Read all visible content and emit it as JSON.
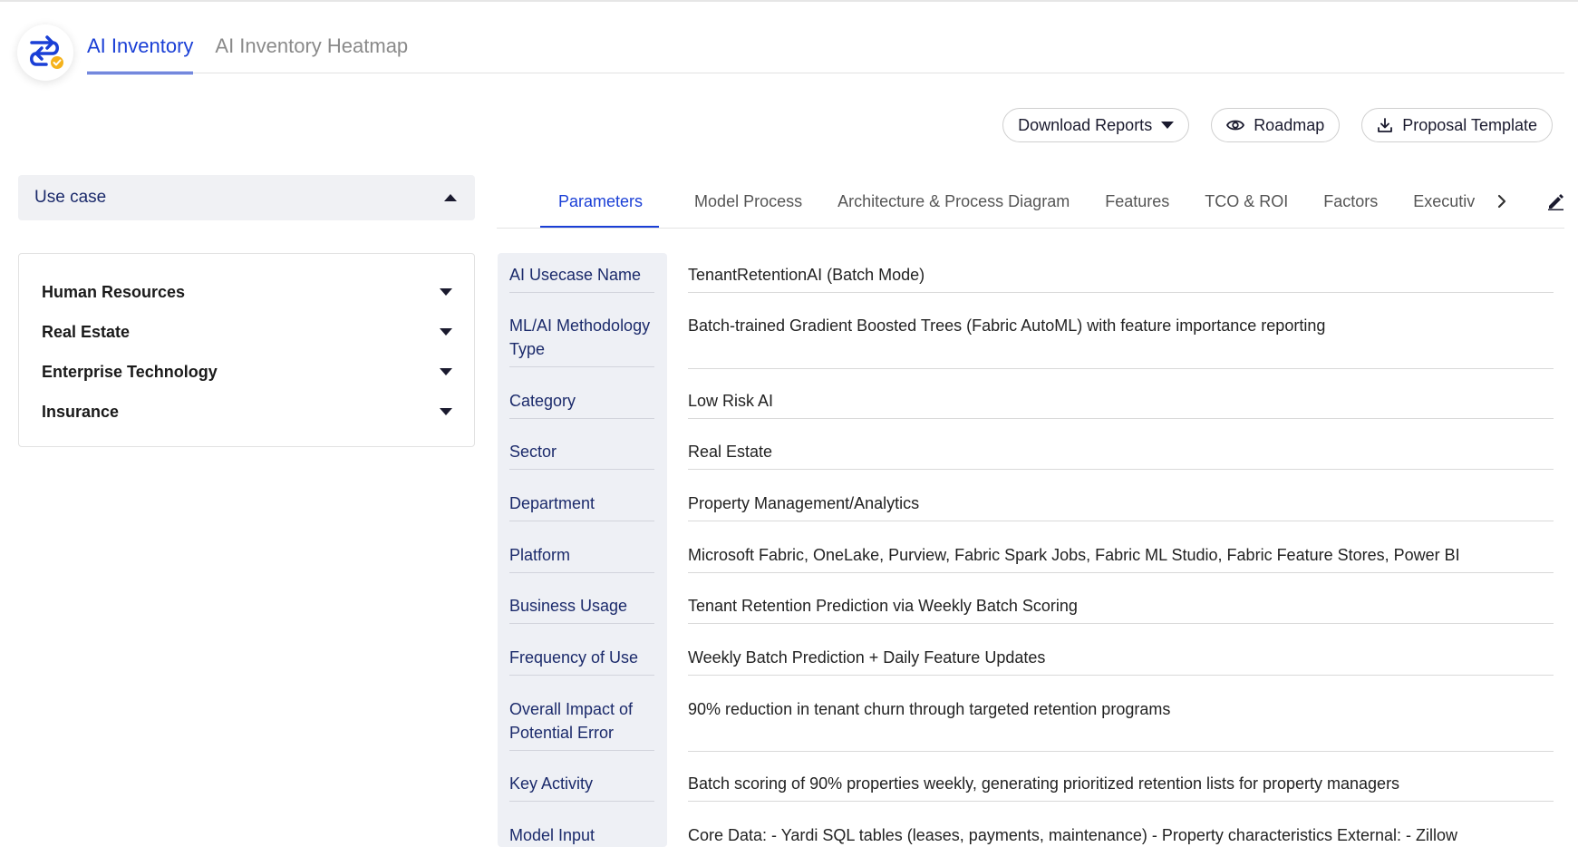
{
  "header": {
    "tabs": [
      {
        "label": "AI Inventory",
        "active": true
      },
      {
        "label": "AI Inventory Heatmap",
        "active": false
      }
    ]
  },
  "actions": {
    "download_label": "Download Reports",
    "roadmap_label": "Roadmap",
    "proposal_label": "Proposal Template"
  },
  "sidebar": {
    "usecase_label": "Use case",
    "sectors": [
      {
        "label": "Human Resources"
      },
      {
        "label": "Real Estate"
      },
      {
        "label": "Enterprise Technology"
      },
      {
        "label": "Insurance"
      }
    ]
  },
  "subtabs": [
    {
      "label": "Parameters",
      "active": true
    },
    {
      "label": "Model Process"
    },
    {
      "label": "Architecture & Process Diagram"
    },
    {
      "label": "Features"
    },
    {
      "label": "TCO & ROI"
    },
    {
      "label": "Factors"
    },
    {
      "label": "Executive"
    }
  ],
  "parameters": [
    {
      "label": "AI Usecase Name",
      "value": "TenantRetentionAI (Batch Mode)"
    },
    {
      "label": "ML/AI Methodology Type",
      "value": "Batch-trained Gradient Boosted Trees (Fabric AutoML) with feature importance reporting"
    },
    {
      "label": "Category",
      "value": "Low Risk AI"
    },
    {
      "label": "Sector",
      "value": "Real Estate"
    },
    {
      "label": "Department",
      "value": "Property Management/Analytics"
    },
    {
      "label": "Platform",
      "value": "Microsoft Fabric, OneLake, Purview, Fabric Spark Jobs, Fabric ML Studio, Fabric Feature Stores, Power BI"
    },
    {
      "label": "Business Usage",
      "value": "Tenant Retention Prediction via Weekly Batch Scoring"
    },
    {
      "label": "Frequency of Use",
      "value": "Weekly Batch Prediction + Daily Feature Updates"
    },
    {
      "label": "Overall Impact of Potential Error",
      "value": "90% reduction in tenant churn through targeted retention programs"
    },
    {
      "label": "Key Activity",
      "value": "Batch scoring of 90% properties weekly, generating prioritized retention lists for property managers"
    },
    {
      "label": "Model Input",
      "value": "Core Data: - Yardi SQL tables (leases, payments, maintenance) - Property characteristics External: - Zillow"
    }
  ],
  "colors": {
    "accent": "#1a3fd6",
    "label_text": "#1b2a6b",
    "badge": "#f5b21b"
  },
  "icons": {
    "logo": "sync-arrows-check-icon",
    "eye": "eye-icon",
    "download": "download-icon",
    "next": "chevron-right-icon",
    "edit": "pencil-icon"
  }
}
